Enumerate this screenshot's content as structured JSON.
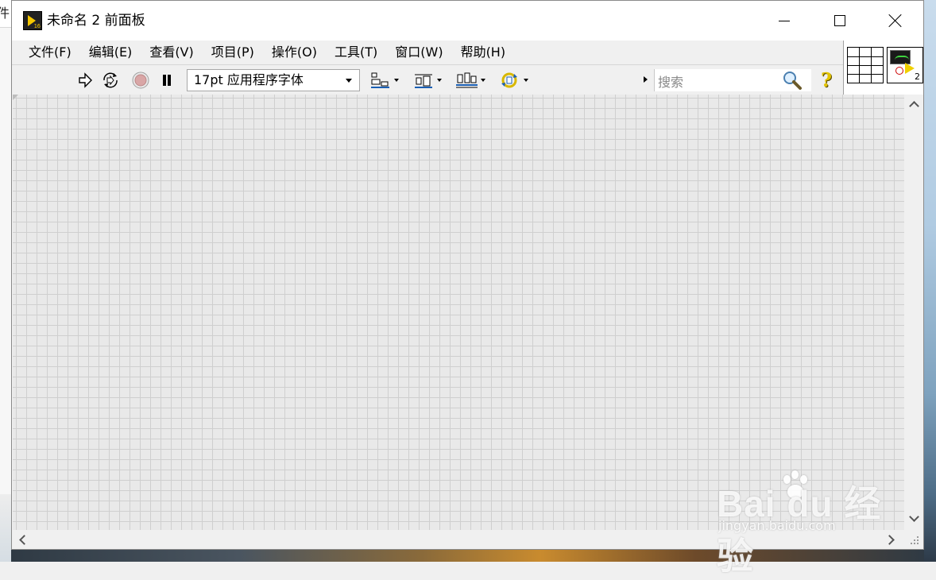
{
  "background": {
    "left_window_fragment": "件"
  },
  "window": {
    "title": "未命名 2 前面板",
    "controls": {
      "minimize": "minimize-icon",
      "maximize": "maximize-icon",
      "close": "close-icon"
    }
  },
  "menu": {
    "items": [
      {
        "label": "文件(F)"
      },
      {
        "label": "编辑(E)"
      },
      {
        "label": "查看(V)"
      },
      {
        "label": "项目(P)"
      },
      {
        "label": "操作(O)"
      },
      {
        "label": "工具(T)"
      },
      {
        "label": "窗口(W)"
      },
      {
        "label": "帮助(H)"
      }
    ]
  },
  "toolbar": {
    "font_selector": "17pt 应用程序字体",
    "search_placeholder": "搜索",
    "buttons": [
      "run-arrow-icon",
      "run-continuously-icon",
      "abort-icon",
      "pause-icon",
      "align-objects-icon",
      "distribute-objects-icon",
      "resize-objects-icon",
      "reorder-icon",
      "help-icon"
    ]
  },
  "connector": {
    "icon_number": "2"
  },
  "watermark": {
    "brand": "Bai du 经验",
    "url": "jingyan.baidu.com"
  },
  "colors": {
    "panel_bg": "#e9e9e9",
    "grid_line": "#cfcfcf",
    "help_icon": "#e2c300",
    "abort_button": "#d9a6a6"
  }
}
